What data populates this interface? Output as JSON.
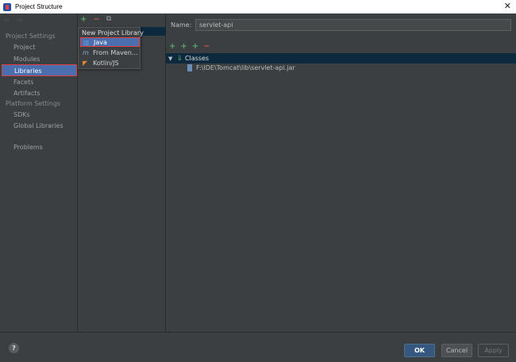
{
  "window": {
    "title": "Project Structure",
    "close_glyph": "✕"
  },
  "sidebar": {
    "nav_arrows": "⇦ ⇨",
    "project_settings_title": "Project Settings",
    "project_settings_items": [
      "Project",
      "Modules",
      "Libraries",
      "Facets",
      "Artifacts"
    ],
    "platform_settings_title": "Platform Settings",
    "platform_settings_items": [
      "SDKs",
      "Global Libraries"
    ],
    "other_items": [
      "Problems"
    ],
    "selected": "Libraries"
  },
  "middle_toolbar": {
    "add": "+",
    "remove": "−",
    "copy": "⧉"
  },
  "popup": {
    "title": "New Project Library",
    "items": [
      {
        "label": "Java",
        "icon": "library-icon",
        "glyph": "▥"
      },
      {
        "label": "From Maven...",
        "icon": "maven-icon",
        "glyph": "m"
      },
      {
        "label": "Kotlin/JS",
        "icon": "kotlin-icon",
        "glyph": "◤"
      }
    ],
    "selected": "Java"
  },
  "library": {
    "name_label": "Name:",
    "name_value": "servlet-api",
    "toolbar": {
      "add": "+",
      "add_classes": "+",
      "add_alt": "+",
      "remove": "−"
    },
    "tree": {
      "expander": "▼",
      "classes_icon": "⇓",
      "classes_label": "Classes",
      "jar_path": "F:\\IDE\\Tomcat\\lib\\servlet-api.jar"
    }
  },
  "footer": {
    "help": "?",
    "ok": "OK",
    "cancel": "Cancel",
    "apply": "Apply"
  },
  "colors": {
    "selection": "#4b6eaf",
    "highlight_border": "#e04040",
    "tree_selection": "#0d293e",
    "add_green": "#59a869",
    "remove_red": "#c75450"
  }
}
